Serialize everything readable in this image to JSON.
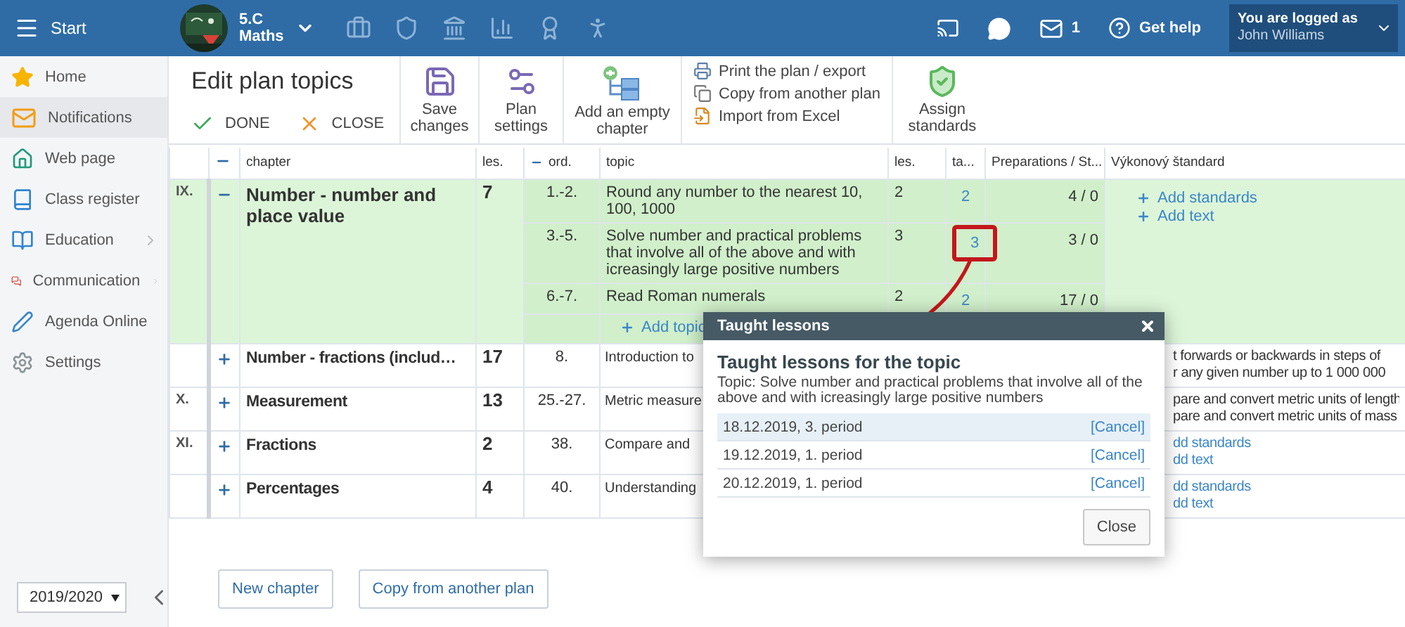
{
  "topbar": {
    "menu_label": "Start",
    "class_name": "5.C",
    "subject": "Maths",
    "messages_count": "1",
    "help_label": "Get help",
    "login_caption": "You are logged as",
    "user_name": "John Williams"
  },
  "sidebar": {
    "items": [
      {
        "label": "Home",
        "selected": false,
        "has_submenu": false
      },
      {
        "label": "Notifications",
        "selected": true,
        "has_submenu": false
      },
      {
        "label": "Web page",
        "selected": false,
        "has_submenu": false
      },
      {
        "label": "Class register",
        "selected": false,
        "has_submenu": false
      },
      {
        "label": "Education",
        "selected": false,
        "has_submenu": true
      },
      {
        "label": "Communication",
        "selected": false,
        "has_submenu": true
      },
      {
        "label": "Agenda Online",
        "selected": false,
        "has_submenu": false
      },
      {
        "label": "Settings",
        "selected": false,
        "has_submenu": false
      }
    ],
    "year": "2019/2020"
  },
  "toolbar": {
    "title": "Edit plan topics",
    "done": "DONE",
    "close": "CLOSE",
    "buttons": [
      "Save changes",
      "Plan settings",
      "Add an empty chapter"
    ],
    "links": [
      "Print the plan / export",
      "Copy from another plan",
      "Import from Excel"
    ],
    "assign": "Assign standards"
  },
  "table": {
    "columns": [
      "chapter",
      "les.",
      "ord.",
      "topic",
      "les.",
      "ta...",
      "Preparations / St...",
      "Výkonový štandard"
    ],
    "chapters": [
      {
        "number": "IX.",
        "title": "Number - number and place value",
        "lessons": "7",
        "expanded": true,
        "topics": [
          {
            "order": "1.-2.",
            "text": "Round any number to the nearest 10, 100, 1000",
            "lessons": "2",
            "taught": "2",
            "preparations": "4 / 0",
            "highlighted": false
          },
          {
            "order": "3.-5.",
            "text": "Solve number and practical problems that involve all of the above and with icreasingly large positive numbers",
            "lessons": "3",
            "taught": "3",
            "preparations": "3 / 0",
            "highlighted": true
          },
          {
            "order": "6.-7.",
            "text": "Read Roman numerals",
            "lessons": "2",
            "taught": "2",
            "preparations": "17 / 0",
            "highlighted": false
          }
        ],
        "add_topic": "Add topic",
        "standards": [
          {
            "kind": "link",
            "text": "Add standards"
          },
          {
            "kind": "link",
            "text": "Add text"
          }
        ]
      },
      {
        "title": "Number - fractions (includ…",
        "lessons": "17",
        "expanded": false,
        "topics": [
          {
            "order": "8.",
            "text": "Introduction to"
          }
        ],
        "standards": [
          {
            "kind": "text",
            "text": "t forwards or backwards in steps of"
          },
          {
            "kind": "text",
            "text": "r any given number up to 1 000 000"
          }
        ]
      },
      {
        "number": "X.",
        "title": "Measurement",
        "lessons": "13",
        "expanded": false,
        "topics": [
          {
            "order": "25.-27.",
            "text": "Metric measure"
          }
        ],
        "standards": [
          {
            "kind": "text",
            "text": "pare and convert metric units of length"
          },
          {
            "kind": "text",
            "text": "pare and convert metric units of mass"
          }
        ]
      },
      {
        "number": "XI.",
        "title": "Fractions",
        "lessons": "2",
        "expanded": false,
        "topics": [
          {
            "order": "38.",
            "text": "Compare and"
          }
        ],
        "standards": [
          {
            "kind": "link",
            "text": "dd standards"
          },
          {
            "kind": "link",
            "text": "dd text"
          }
        ]
      },
      {
        "title": "Percentages",
        "lessons": "4",
        "expanded": false,
        "topics": [
          {
            "order": "40.",
            "text": "Understanding"
          }
        ],
        "standards": [
          {
            "kind": "link",
            "text": "dd standards"
          },
          {
            "kind": "link",
            "text": "dd text"
          }
        ]
      }
    ]
  },
  "bottom_buttons": [
    "New chapter",
    "Copy from another plan"
  ],
  "dialog": {
    "title": "Taught lessons",
    "heading": "Taught lessons for the topic",
    "description": "Topic: Solve number and practical problems that involve all of the above and with icreasingly large positive numbers",
    "lessons": [
      {
        "date": "18.12.2019, 3. period",
        "action": "[Cancel]",
        "selected": true
      },
      {
        "date": "19.12.2019, 1. period",
        "action": "[Cancel]",
        "selected": false
      },
      {
        "date": "20.12.2019, 1. period",
        "action": "[Cancel]",
        "selected": false
      }
    ],
    "close": "Close"
  }
}
